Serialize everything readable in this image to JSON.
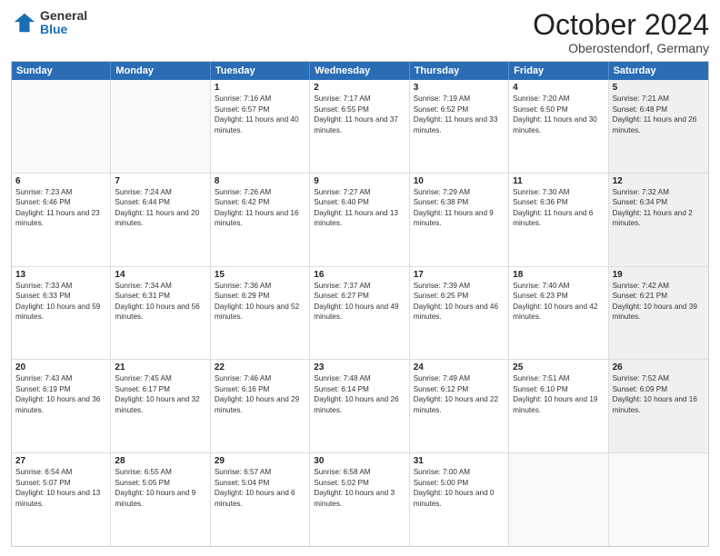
{
  "header": {
    "logo": {
      "general": "General",
      "blue": "Blue"
    },
    "title": "October 2024",
    "subtitle": "Oberostendorf, Germany"
  },
  "weekdays": [
    "Sunday",
    "Monday",
    "Tuesday",
    "Wednesday",
    "Thursday",
    "Friday",
    "Saturday"
  ],
  "rows": [
    [
      {
        "day": "",
        "sunrise": "",
        "sunset": "",
        "daylight": "",
        "shaded": false,
        "empty": true
      },
      {
        "day": "",
        "sunrise": "",
        "sunset": "",
        "daylight": "",
        "shaded": false,
        "empty": true
      },
      {
        "day": "1",
        "sunrise": "Sunrise: 7:16 AM",
        "sunset": "Sunset: 6:57 PM",
        "daylight": "Daylight: 11 hours and 40 minutes.",
        "shaded": false
      },
      {
        "day": "2",
        "sunrise": "Sunrise: 7:17 AM",
        "sunset": "Sunset: 6:55 PM",
        "daylight": "Daylight: 11 hours and 37 minutes.",
        "shaded": false
      },
      {
        "day": "3",
        "sunrise": "Sunrise: 7:19 AM",
        "sunset": "Sunset: 6:52 PM",
        "daylight": "Daylight: 11 hours and 33 minutes.",
        "shaded": false
      },
      {
        "day": "4",
        "sunrise": "Sunrise: 7:20 AM",
        "sunset": "Sunset: 6:50 PM",
        "daylight": "Daylight: 11 hours and 30 minutes.",
        "shaded": false
      },
      {
        "day": "5",
        "sunrise": "Sunrise: 7:21 AM",
        "sunset": "Sunset: 6:48 PM",
        "daylight": "Daylight: 11 hours and 26 minutes.",
        "shaded": true
      }
    ],
    [
      {
        "day": "6",
        "sunrise": "Sunrise: 7:23 AM",
        "sunset": "Sunset: 6:46 PM",
        "daylight": "Daylight: 11 hours and 23 minutes.",
        "shaded": false
      },
      {
        "day": "7",
        "sunrise": "Sunrise: 7:24 AM",
        "sunset": "Sunset: 6:44 PM",
        "daylight": "Daylight: 11 hours and 20 minutes.",
        "shaded": false
      },
      {
        "day": "8",
        "sunrise": "Sunrise: 7:26 AM",
        "sunset": "Sunset: 6:42 PM",
        "daylight": "Daylight: 11 hours and 16 minutes.",
        "shaded": false
      },
      {
        "day": "9",
        "sunrise": "Sunrise: 7:27 AM",
        "sunset": "Sunset: 6:40 PM",
        "daylight": "Daylight: 11 hours and 13 minutes.",
        "shaded": false
      },
      {
        "day": "10",
        "sunrise": "Sunrise: 7:29 AM",
        "sunset": "Sunset: 6:38 PM",
        "daylight": "Daylight: 11 hours and 9 minutes.",
        "shaded": false
      },
      {
        "day": "11",
        "sunrise": "Sunrise: 7:30 AM",
        "sunset": "Sunset: 6:36 PM",
        "daylight": "Daylight: 11 hours and 6 minutes.",
        "shaded": false
      },
      {
        "day": "12",
        "sunrise": "Sunrise: 7:32 AM",
        "sunset": "Sunset: 6:34 PM",
        "daylight": "Daylight: 11 hours and 2 minutes.",
        "shaded": true
      }
    ],
    [
      {
        "day": "13",
        "sunrise": "Sunrise: 7:33 AM",
        "sunset": "Sunset: 6:33 PM",
        "daylight": "Daylight: 10 hours and 59 minutes.",
        "shaded": false
      },
      {
        "day": "14",
        "sunrise": "Sunrise: 7:34 AM",
        "sunset": "Sunset: 6:31 PM",
        "daylight": "Daylight: 10 hours and 56 minutes.",
        "shaded": false
      },
      {
        "day": "15",
        "sunrise": "Sunrise: 7:36 AM",
        "sunset": "Sunset: 6:29 PM",
        "daylight": "Daylight: 10 hours and 52 minutes.",
        "shaded": false
      },
      {
        "day": "16",
        "sunrise": "Sunrise: 7:37 AM",
        "sunset": "Sunset: 6:27 PM",
        "daylight": "Daylight: 10 hours and 49 minutes.",
        "shaded": false
      },
      {
        "day": "17",
        "sunrise": "Sunrise: 7:39 AM",
        "sunset": "Sunset: 6:25 PM",
        "daylight": "Daylight: 10 hours and 46 minutes.",
        "shaded": false
      },
      {
        "day": "18",
        "sunrise": "Sunrise: 7:40 AM",
        "sunset": "Sunset: 6:23 PM",
        "daylight": "Daylight: 10 hours and 42 minutes.",
        "shaded": false
      },
      {
        "day": "19",
        "sunrise": "Sunrise: 7:42 AM",
        "sunset": "Sunset: 6:21 PM",
        "daylight": "Daylight: 10 hours and 39 minutes.",
        "shaded": true
      }
    ],
    [
      {
        "day": "20",
        "sunrise": "Sunrise: 7:43 AM",
        "sunset": "Sunset: 6:19 PM",
        "daylight": "Daylight: 10 hours and 36 minutes.",
        "shaded": false
      },
      {
        "day": "21",
        "sunrise": "Sunrise: 7:45 AM",
        "sunset": "Sunset: 6:17 PM",
        "daylight": "Daylight: 10 hours and 32 minutes.",
        "shaded": false
      },
      {
        "day": "22",
        "sunrise": "Sunrise: 7:46 AM",
        "sunset": "Sunset: 6:16 PM",
        "daylight": "Daylight: 10 hours and 29 minutes.",
        "shaded": false
      },
      {
        "day": "23",
        "sunrise": "Sunrise: 7:48 AM",
        "sunset": "Sunset: 6:14 PM",
        "daylight": "Daylight: 10 hours and 26 minutes.",
        "shaded": false
      },
      {
        "day": "24",
        "sunrise": "Sunrise: 7:49 AM",
        "sunset": "Sunset: 6:12 PM",
        "daylight": "Daylight: 10 hours and 22 minutes.",
        "shaded": false
      },
      {
        "day": "25",
        "sunrise": "Sunrise: 7:51 AM",
        "sunset": "Sunset: 6:10 PM",
        "daylight": "Daylight: 10 hours and 19 minutes.",
        "shaded": false
      },
      {
        "day": "26",
        "sunrise": "Sunrise: 7:52 AM",
        "sunset": "Sunset: 6:09 PM",
        "daylight": "Daylight: 10 hours and 16 minutes.",
        "shaded": true
      }
    ],
    [
      {
        "day": "27",
        "sunrise": "Sunrise: 6:54 AM",
        "sunset": "Sunset: 5:07 PM",
        "daylight": "Daylight: 10 hours and 13 minutes.",
        "shaded": false
      },
      {
        "day": "28",
        "sunrise": "Sunrise: 6:55 AM",
        "sunset": "Sunset: 5:05 PM",
        "daylight": "Daylight: 10 hours and 9 minutes.",
        "shaded": false
      },
      {
        "day": "29",
        "sunrise": "Sunrise: 6:57 AM",
        "sunset": "Sunset: 5:04 PM",
        "daylight": "Daylight: 10 hours and 6 minutes.",
        "shaded": false
      },
      {
        "day": "30",
        "sunrise": "Sunrise: 6:58 AM",
        "sunset": "Sunset: 5:02 PM",
        "daylight": "Daylight: 10 hours and 3 minutes.",
        "shaded": false
      },
      {
        "day": "31",
        "sunrise": "Sunrise: 7:00 AM",
        "sunset": "Sunset: 5:00 PM",
        "daylight": "Daylight: 10 hours and 0 minutes.",
        "shaded": false
      },
      {
        "day": "",
        "sunrise": "",
        "sunset": "",
        "daylight": "",
        "shaded": false,
        "empty": true
      },
      {
        "day": "",
        "sunrise": "",
        "sunset": "",
        "daylight": "",
        "shaded": false,
        "empty": true
      }
    ]
  ]
}
